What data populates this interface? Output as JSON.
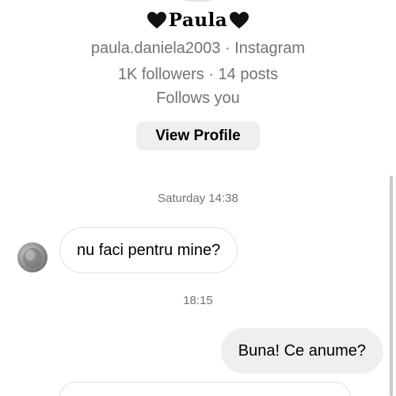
{
  "profile": {
    "name": "Paula",
    "username_line": "paula.daniela2003 · Instagram",
    "stats_line": "1K followers · 14 posts",
    "follows_you": "Follows you",
    "view_profile_label": "View Profile",
    "heart_icon": "black-heart-icon"
  },
  "messages": [
    {
      "timestamp": "Saturday 14:38",
      "direction": "incoming",
      "text": "nu faci pentru mine?"
    },
    {
      "timestamp": "18:15",
      "direction": "outgoing",
      "text": "Buna! Ce anume?"
    }
  ],
  "colors": {
    "secondary_text": "#737373",
    "button_bg": "#efefef",
    "outgoing_bubble_bg": "#efefef",
    "incoming_bubble_border": "#e2e2e2"
  }
}
